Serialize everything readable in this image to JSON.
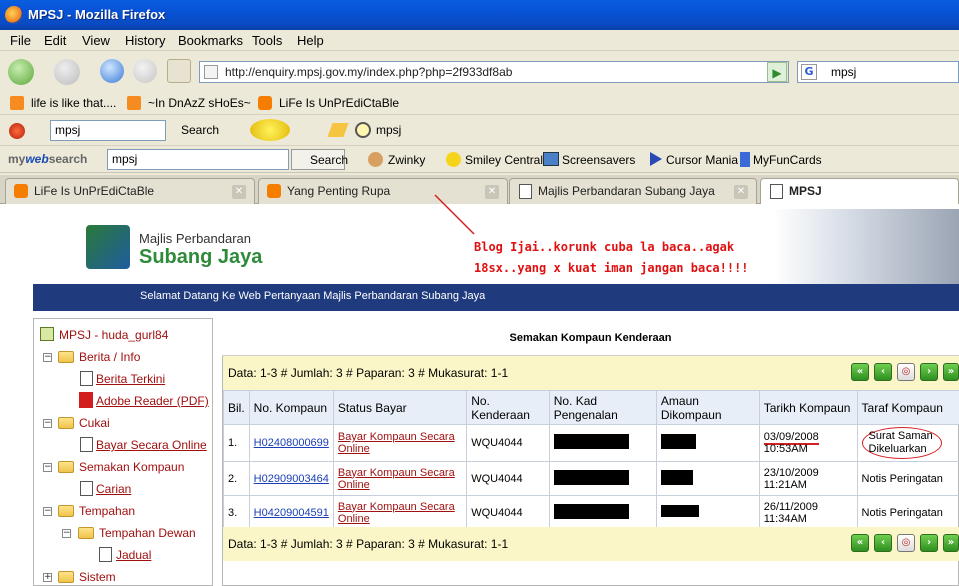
{
  "window": {
    "title": "MPSJ - Mozilla Firefox"
  },
  "menu": [
    "File",
    "Edit",
    "View",
    "History",
    "Bookmarks",
    "Tools",
    "Help"
  ],
  "nav": {
    "url": "http://enquiry.mpsj.gov.my/index.php?php=2f933df8ab",
    "search_value": "mpsj"
  },
  "bookmarks": [
    "life is like that....",
    "~In DnAzZ sHoEs~",
    "LiFe Is UnPrEdiCtaBle"
  ],
  "toolbar1": {
    "search_value": "mpsj",
    "search_label": "Search",
    "extra": "mpsj"
  },
  "toolbar2": {
    "brand_my": "my",
    "brand_web": "web",
    "brand_search": "search",
    "search_value": "mpsj",
    "search_btn": "Search",
    "items": [
      "Zwinky",
      "Smiley Central",
      "Screensavers",
      "Cursor Mania",
      "MyFunCards"
    ]
  },
  "tabs": [
    "LiFe Is UnPrEdiCtaBle",
    "Yang Penting Rupa",
    "Majlis Perbandaran Subang Jaya",
    "MPSJ"
  ],
  "site": {
    "logo_line1": "Majlis Perbandaran",
    "logo_line2": "Subang Jaya",
    "welcome": "Selamat Datang Ke Web Pertanyaan Majlis Perbandaran Subang Jaya"
  },
  "annotation": {
    "line1": "Blog Ijai..korunk cuba la baca..agak",
    "line2": "18sx..yang x kuat iman jangan baca!!!!"
  },
  "tree": {
    "root": "MPSJ - huda_gurl84",
    "berita": "Berita / Info",
    "berita_terkini": "Berita Terkini",
    "adobe": "Adobe Reader (PDF)",
    "cukai": "Cukai",
    "bayar": "Bayar Secara Online",
    "semakan": "Semakan Kompaun",
    "carian": "Carian",
    "tempahan": "Tempahan",
    "tempahan_dewan": "Tempahan Dewan",
    "jadual": "Jadual",
    "sistem": "Sistem"
  },
  "main": {
    "title": "Semakan Kompaun Kenderaan",
    "info": "Data: 1-3 # Jumlah: 3 # Paparan: 3 # Mukasurat: 1-1",
    "headers": [
      "Bil.",
      "No. Kompaun",
      "Status Bayar",
      "No. Kenderaan",
      "No. Kad Pengenalan",
      "Amaun Dikompaun",
      "Tarikh Kompaun",
      "Taraf Kompaun"
    ],
    "rows": [
      {
        "bil": "1.",
        "no": "H02408000699",
        "status": "Bayar Kompaun Secara Online",
        "kend": "WQU4044",
        "tarikh": "03/09/2008",
        "masa": "10:53AM",
        "taraf": "Surat Saman Dikeluarkan"
      },
      {
        "bil": "2.",
        "no": "H02909003464",
        "status": "Bayar Kompaun Secara Online",
        "kend": "WQU4044",
        "tarikh": "23/10/2009",
        "masa": "11:21AM",
        "taraf": "Notis Peringatan"
      },
      {
        "bil": "3.",
        "no": "H04209004591",
        "status": "Bayar Kompaun Secara Online",
        "kend": "WQU4044",
        "tarikh": "26/11/2009",
        "masa": "11:34AM",
        "taraf": "Notis Peringatan"
      }
    ]
  }
}
